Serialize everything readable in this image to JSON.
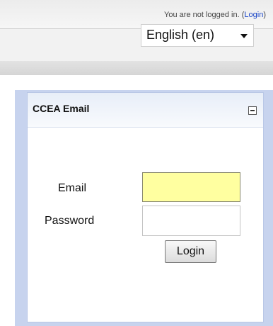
{
  "header": {
    "login_status_prefix": "You are not logged in. (",
    "login_link": "Login",
    "login_status_suffix": ")",
    "language_selected": "English (en)"
  },
  "block": {
    "title": "CCEA Email",
    "email_label": "Email",
    "password_label": "Password",
    "email_value": "",
    "password_value": "",
    "login_button": "Login"
  },
  "colors": {
    "block_border": "#c7d3ee",
    "email_field_background": "#ffffa0",
    "link": "#1a46c8"
  }
}
